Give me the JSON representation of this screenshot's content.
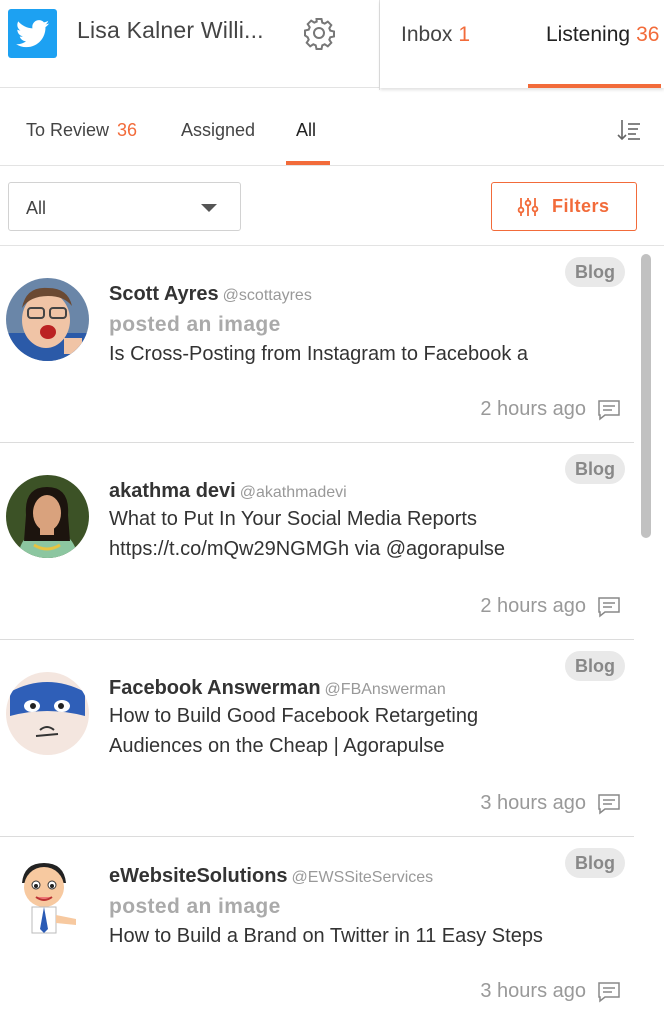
{
  "account": {
    "name": "Lisa Kalner Willi...",
    "network_icon": "twitter-icon",
    "settings_icon": "gear-icon"
  },
  "top_tabs": [
    {
      "label": "Inbox",
      "count": "1"
    },
    {
      "label": "Listening",
      "count": "36"
    }
  ],
  "sub_tabs": [
    {
      "label": "To Review",
      "count": "36"
    },
    {
      "label": "Assigned"
    },
    {
      "label": "All"
    }
  ],
  "filter": {
    "selected": "All",
    "button_label": "Filters"
  },
  "colors": {
    "accent": "#f26b3a",
    "twitter": "#1da1f2"
  },
  "feed": [
    {
      "badge": "Blog",
      "name": "Scott Ayres",
      "handle": "@scottayres",
      "action": "posted an image",
      "lines": [
        "Is Cross-Posting from Instagram to Facebook a"
      ],
      "time": "2 hours ago"
    },
    {
      "badge": "Blog",
      "name": "akathma devi",
      "handle": "@akathmadevi",
      "action": "",
      "lines": [
        "What to Put In Your Social Media Reports",
        "https://t.co/mQw29NGMGh via @agorapulse"
      ],
      "time": "2 hours ago"
    },
    {
      "badge": "Blog",
      "name": "Facebook Answerman",
      "handle": "@FBAnswerman",
      "action": "",
      "lines": [
        "How to Build Good Facebook Retargeting",
        "Audiences on the Cheap | Agorapulse"
      ],
      "time": "3 hours ago"
    },
    {
      "badge": "Blog",
      "name": "eWebsiteSolutions",
      "handle": "@EWSSiteServices",
      "action": "posted an image",
      "lines": [
        "How to Build a Brand on Twitter in 11 Easy Steps"
      ],
      "time": "3 hours ago"
    }
  ]
}
